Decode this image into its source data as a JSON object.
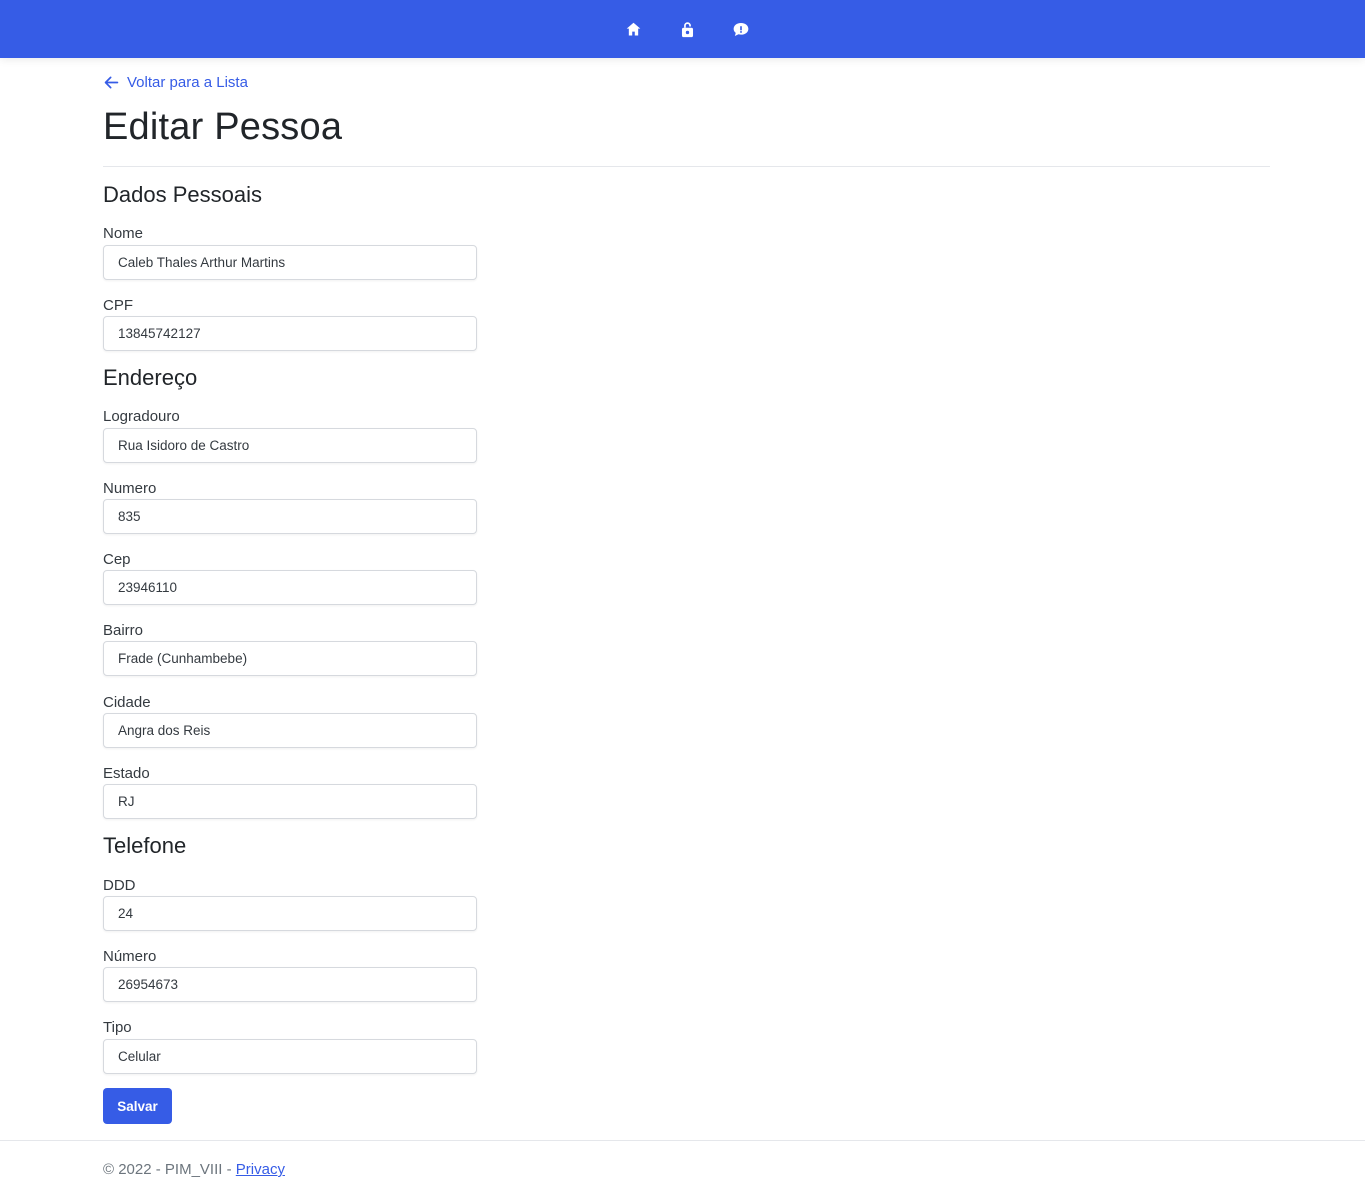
{
  "header": {
    "nav_icons": [
      "home-icon",
      "lock-icon",
      "chat-icon"
    ],
    "accent_color": "#365ce6"
  },
  "page": {
    "back_link": "Voltar para a Lista",
    "title": "Editar Pessoa"
  },
  "sections": {
    "personal": {
      "heading": "Dados Pessoais",
      "nome_label": "Nome",
      "nome_value": "Caleb Thales Arthur Martins",
      "cpf_label": "CPF",
      "cpf_value": "13845742127"
    },
    "address": {
      "heading": "Endereço",
      "logradouro_label": "Logradouro",
      "logradouro_value": "Rua Isidoro de Castro",
      "numero_label": "Numero",
      "numero_value": "835",
      "cep_label": "Cep",
      "cep_value": "23946110",
      "bairro_label": "Bairro",
      "bairro_value": "Frade (Cunhambebe)",
      "cidade_label": "Cidade",
      "cidade_value": "Angra dos Reis",
      "estado_label": "Estado",
      "estado_value": "RJ"
    },
    "phone": {
      "heading": "Telefone",
      "ddd_label": "DDD",
      "ddd_value": "24",
      "numero_label": "Número",
      "numero_value": "26954673",
      "tipo_label": "Tipo",
      "tipo_value": "Celular"
    }
  },
  "form": {
    "save_label": "Salvar"
  },
  "footer": {
    "copyright": "© 2022 - PIM_VIII - ",
    "privacy_link": "Privacy"
  }
}
